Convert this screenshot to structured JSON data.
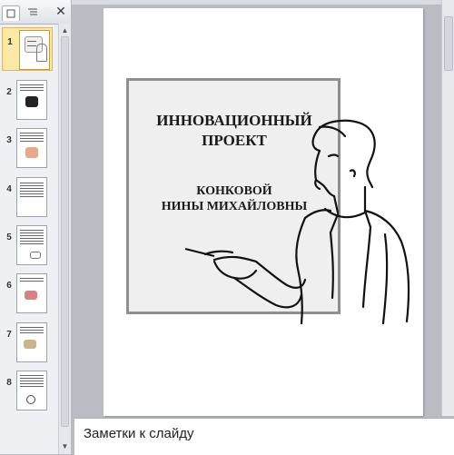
{
  "left_pane": {
    "tabs": [
      {
        "name": "slides",
        "icon": "slides-tab-icon"
      },
      {
        "name": "outline",
        "icon": "outline-tab-icon"
      }
    ],
    "close_glyph": "✕"
  },
  "thumbnails": [
    {
      "num": "1",
      "selected": true
    },
    {
      "num": "2",
      "selected": false
    },
    {
      "num": "3",
      "selected": false
    },
    {
      "num": "4",
      "selected": false
    },
    {
      "num": "5",
      "selected": false
    },
    {
      "num": "6",
      "selected": false
    },
    {
      "num": "7",
      "selected": false
    },
    {
      "num": "8",
      "selected": false
    }
  ],
  "slide": {
    "title_line1": "ИННОВАЦИОННЫЙ",
    "title_line2": "ПРОЕКТ",
    "author_line1": "КОНКОВОЙ",
    "author_line2": "НИНЫ МИХАЙЛОВНЫ"
  },
  "notes": {
    "placeholder": "Заметки к слайду"
  },
  "colors": {
    "selected_thumb_bg": "#fde9a6",
    "frame_border": "#8f8f8f",
    "workspace_bg": "#b9bcc3"
  }
}
